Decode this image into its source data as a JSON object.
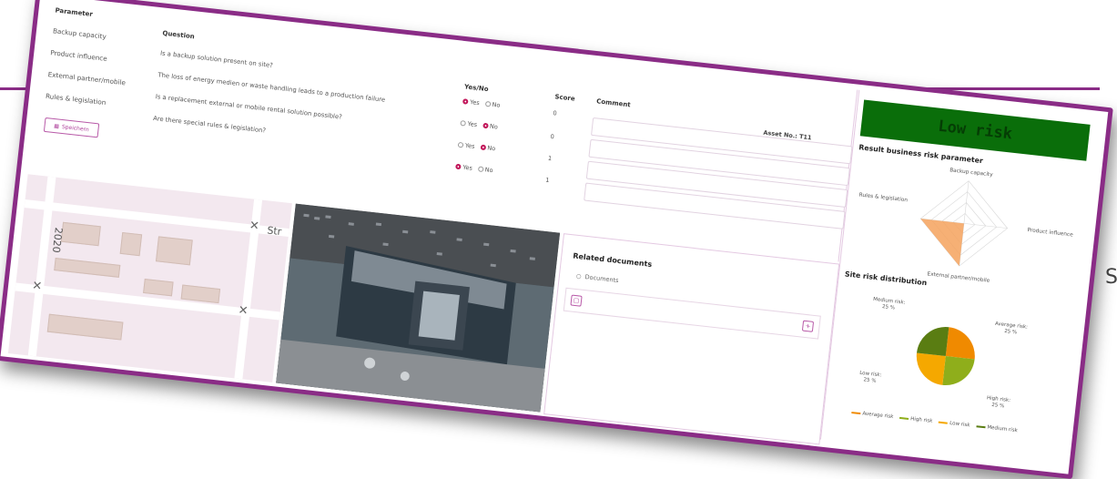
{
  "background": {
    "side_letter": "S"
  },
  "params": {
    "headers": {
      "parameter": "Parameter",
      "question": "Question",
      "yes_no": "Yes/No",
      "score": "Score",
      "comment": "Comment"
    },
    "asset_no": "Asset No.: T11",
    "rows": [
      {
        "parameter": "Backup capacity",
        "question": "Is a backup solution present on site?",
        "yes_label": "Yes",
        "no_label": "No",
        "answer": "yes",
        "score": "0"
      },
      {
        "parameter": "Product influence",
        "question": "The loss of energy medien or waste handling leads to a production failure",
        "yes_label": "Yes",
        "no_label": "No",
        "answer": "no",
        "score": "0"
      },
      {
        "parameter": "External partner/mobile",
        "question": "Is a replacement external or mobile rental solution possible?",
        "yes_label": "Yes",
        "no_label": "No",
        "answer": "no",
        "score": "1"
      },
      {
        "parameter": "Rules & legislation",
        "question": "Are there special rules & legislation?",
        "yes_label": "Yes",
        "no_label": "No",
        "answer": "yes",
        "score": "1"
      }
    ],
    "save_button": "Speichern"
  },
  "risk": {
    "banner": "Low risk",
    "banner_color": "#0a6e0a",
    "result_title": "Result business risk parameter",
    "radar_labels": {
      "top": "Backup capacity",
      "right": "Product influence",
      "bottom": "External partner/mobile",
      "left": "Rules & legislation"
    },
    "distribution_title": "Site risk distribution",
    "pie_labels": {
      "medium": "Medium risk:\n25 %",
      "average": "Average risk:\n25 %",
      "low": "Low risk:\n25 %",
      "high": "High risk:\n25 %"
    },
    "legend": [
      {
        "label": "Average risk",
        "color": "#f08a00"
      },
      {
        "label": "High risk",
        "color": "#8fae1b"
      },
      {
        "label": "Low risk",
        "color": "#f5a800"
      },
      {
        "label": "Medium risk",
        "color": "#5a7d12"
      }
    ]
  },
  "map": {
    "label_num": "2020",
    "label_street": "Str"
  },
  "documents": {
    "title": "Related documents",
    "item": "Documents",
    "add_symbol": "+"
  }
}
